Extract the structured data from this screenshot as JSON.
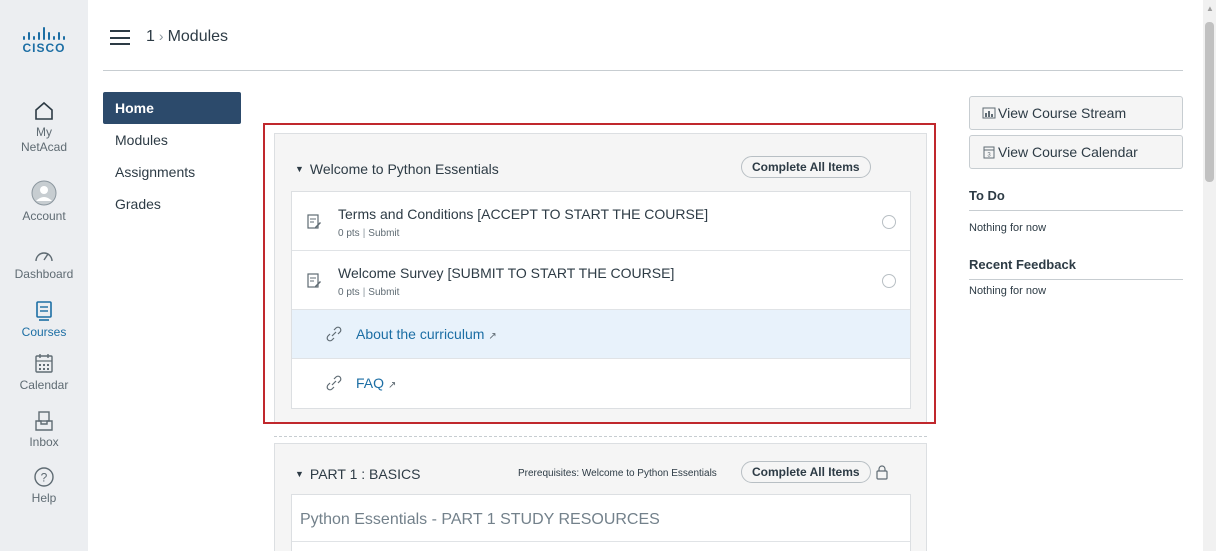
{
  "brand": {
    "logo_text": "CISCO",
    "accent": "#1c6ea4",
    "nav_active_bg": "#2c4a6b",
    "highlight_frame": "#c0282d"
  },
  "global_nav": {
    "my_netacad_line1": "My",
    "my_netacad_line2": "NetAcad",
    "account": "Account",
    "dashboard": "Dashboard",
    "courses": "Courses",
    "calendar": "Calendar",
    "inbox": "Inbox",
    "help": "Help"
  },
  "header": {
    "breadcrumb_course": "1",
    "breadcrumb_sep": "›",
    "breadcrumb_current": "Modules"
  },
  "course_nav": {
    "home": "Home",
    "modules": "Modules",
    "assignments": "Assignments",
    "grades": "Grades"
  },
  "module_welcome": {
    "title": "Welcome to Python Essentials",
    "complete_all": "Complete All Items",
    "items": [
      {
        "title": "Terms and Conditions [ACCEPT TO START THE COURSE]",
        "pts": "0 pts",
        "sep": "|",
        "action": "Submit"
      },
      {
        "title": "Welcome Survey [SUBMIT TO START THE COURSE]",
        "pts": "0 pts",
        "sep": "|",
        "action": "Submit"
      },
      {
        "title": "About the curriculum"
      },
      {
        "title": "FAQ"
      }
    ]
  },
  "module_part1": {
    "title": "PART 1 : BASICS",
    "prerequisites": "Prerequisites: Welcome to Python Essentials",
    "complete_all": "Complete All Items",
    "subheader": "Python Essentials - PART 1 STUDY RESOURCES"
  },
  "sidebar": {
    "view_stream": "View Course Stream",
    "view_calendar": "View Course Calendar",
    "todo_heading": "To Do",
    "todo_text": "Nothing for now",
    "feedback_heading": "Recent Feedback",
    "feedback_text": "Nothing for now"
  }
}
